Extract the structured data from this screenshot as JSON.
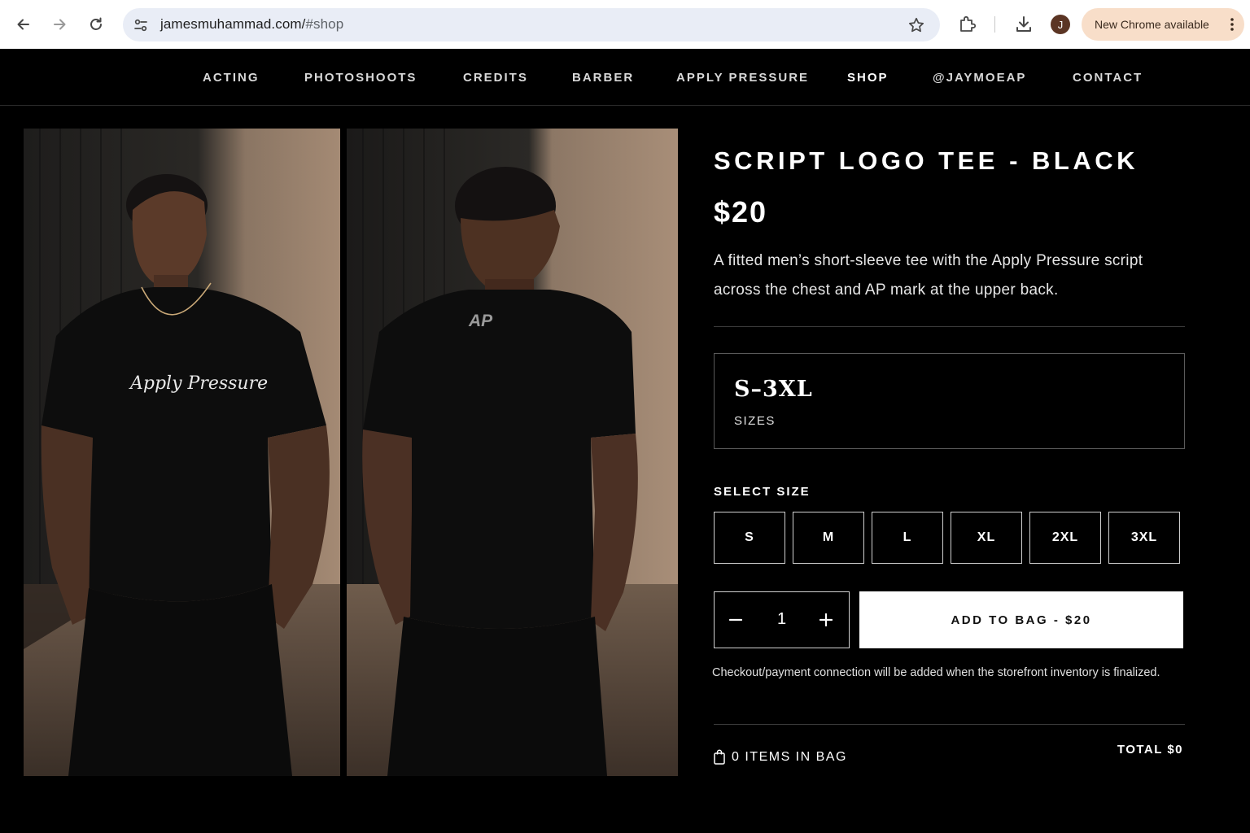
{
  "browser": {
    "url_host": "jamesmuhammad.com/",
    "url_path": "#shop",
    "profile_initial": "J",
    "update_label": "New Chrome available",
    "icons": [
      "back-icon",
      "forward-icon",
      "reload-icon",
      "site-settings-icon",
      "bookmark-star-icon",
      "extensions-icon",
      "download-icon",
      "more-vert-icon"
    ],
    "update_pill_color": "#f8dec9"
  },
  "nav": {
    "items": [
      "ACTING",
      "PHOTOSHOOTS",
      "CREDITS",
      "BARBER",
      "APPLY PRESSURE",
      "SHOP",
      "@JAYMOEAP",
      "CONTACT"
    ],
    "active": "SHOP"
  },
  "gallery": {
    "front_print": "Apply Pressure",
    "back_print": "AP"
  },
  "product": {
    "title": "SCRIPT LOGO TEE - BLACK",
    "price": "$20",
    "description": "A fitted men’s short-sleeve tee with the Apply Pressure script across the chest and AP mark at the upper back.",
    "size_range": "S–3XL",
    "size_caption": "SIZES",
    "select_size_label": "SELECT SIZE",
    "sizes": [
      "S",
      "M",
      "L",
      "XL",
      "2XL",
      "3XL"
    ],
    "quantity": "1",
    "add_to_bag_label": "ADD TO BAG - $20",
    "checkout_note": "Checkout/payment connection will be added when the storefront inventory is finalized.",
    "bag_count_label": "0 ITEMS IN BAG",
    "total_label": "TOTAL $0"
  },
  "colors": {
    "page_background": "#000000",
    "primary_button": "#ffffff",
    "primary_button_text": "#111111"
  }
}
